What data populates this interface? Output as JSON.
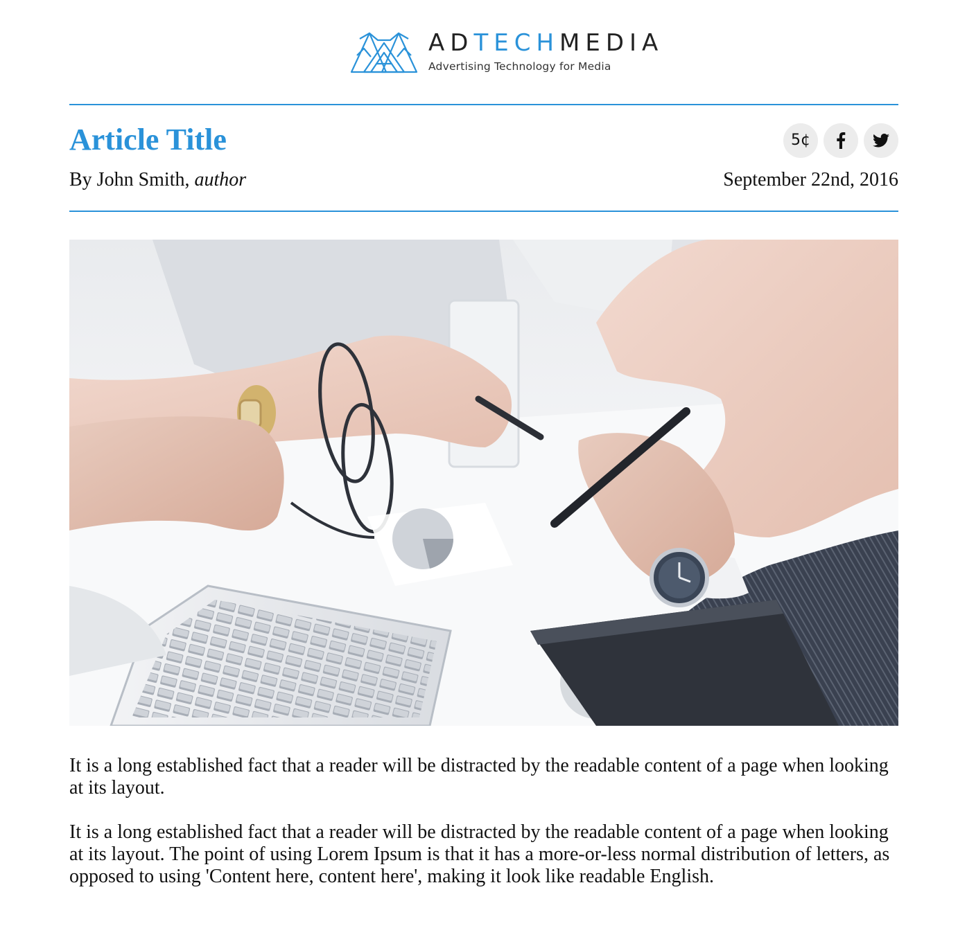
{
  "brand": {
    "name_part1": "AD",
    "name_part2": "TECH",
    "name_part3": "MEDIA",
    "tagline": "Advertising Technology for Media",
    "accent_color": "#2a92d9"
  },
  "article": {
    "title": "Article Title",
    "byline_prefix": "By John Smith, ",
    "byline_role": "author",
    "date": "September 22nd, 2016",
    "paragraphs": [
      "It is a long established fact that a reader will be distracted by the readable content of a page when looking at its layout.",
      "It is a long established fact that a reader will be distracted by the readable content of a page when looking at its layout. The point of using Lorem Ipsum is that it has a more-or-less normal distribution of letters, as opposed to using 'Content here, content here', making it look like readable English."
    ]
  },
  "share": {
    "tip_label": "5¢",
    "facebook_icon": "facebook-icon",
    "twitter_icon": "twitter-icon"
  },
  "hero_image": {
    "icon": "business-meeting-photo"
  }
}
